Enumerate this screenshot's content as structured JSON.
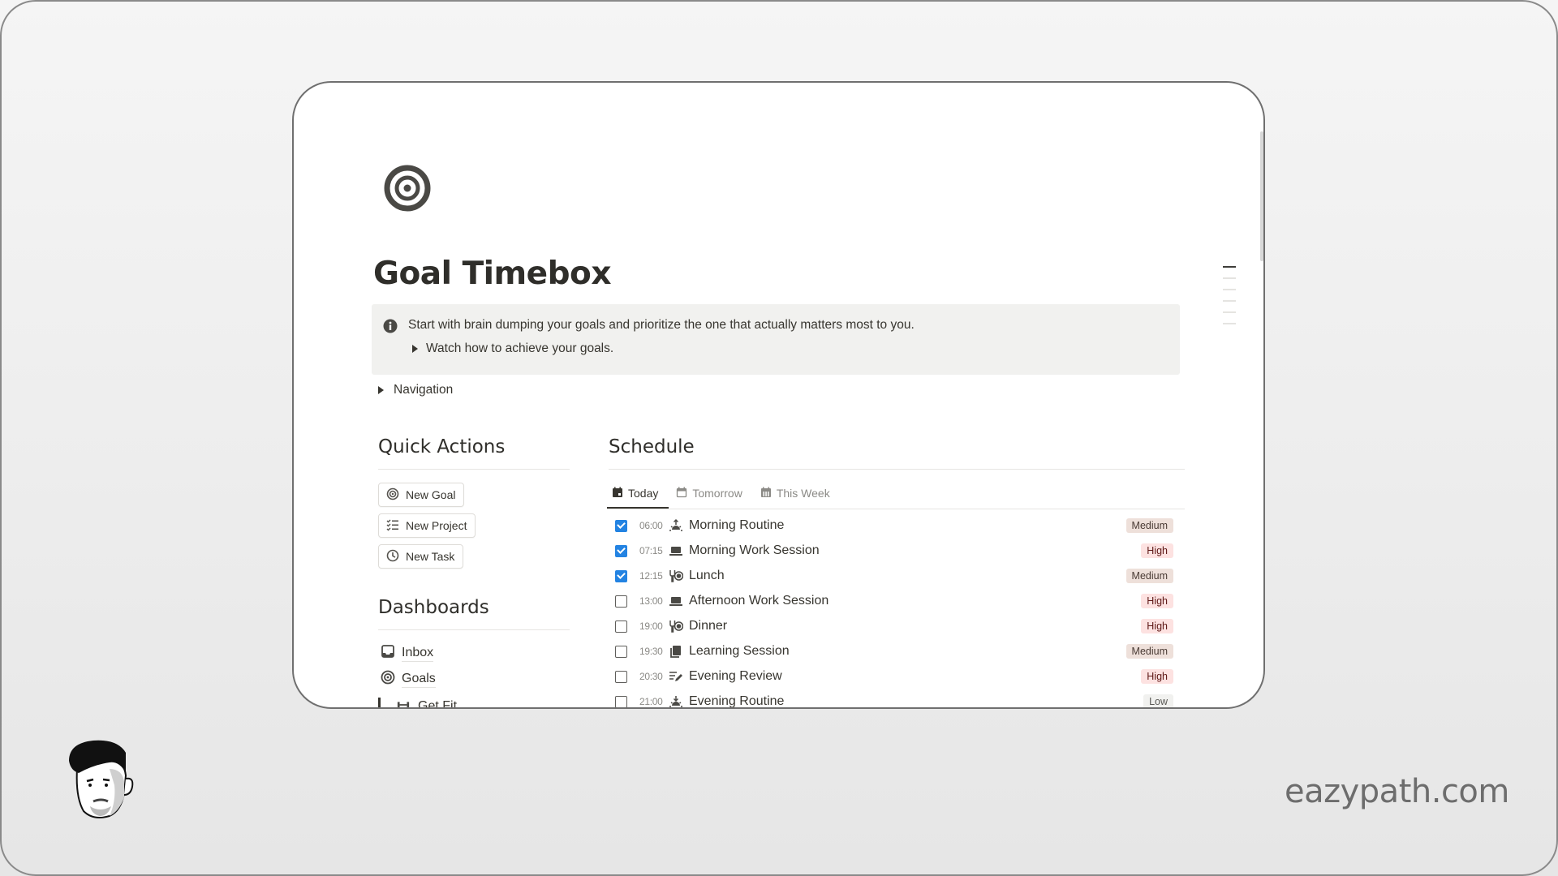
{
  "page": {
    "title": "Goal Timebox",
    "icon": "target-icon"
  },
  "callout": {
    "icon": "info-icon",
    "text": "Start with brain dumping your goals and prioritize the one that actually matters most to you.",
    "toggle_label": "Watch how to achieve your goals."
  },
  "navigation_toggle": "Navigation",
  "quick_actions": {
    "title": "Quick Actions",
    "buttons": [
      {
        "label": "New Goal",
        "icon": "target-icon"
      },
      {
        "label": "New Project",
        "icon": "checklist-icon"
      },
      {
        "label": "New Task",
        "icon": "clock-icon"
      }
    ]
  },
  "dashboards": {
    "title": "Dashboards",
    "items": [
      {
        "label": "Inbox",
        "icon": "inbox-icon"
      },
      {
        "label": "Goals",
        "icon": "target-icon"
      },
      {
        "label": "Get Fit",
        "icon": "dumbbell-icon"
      }
    ]
  },
  "schedule": {
    "title": "Schedule",
    "tabs": [
      {
        "label": "Today",
        "icon": "calendar-filled-icon",
        "active": true
      },
      {
        "label": "Tomorrow",
        "icon": "calendar-icon",
        "active": false
      },
      {
        "label": "This Week",
        "icon": "calendar-week-icon",
        "active": false
      }
    ],
    "rows": [
      {
        "done": true,
        "time": "06:00",
        "icon": "sunrise-icon",
        "name": "Morning Routine",
        "priority": "Medium"
      },
      {
        "done": true,
        "time": "07:15",
        "icon": "laptop-icon",
        "name": "Morning Work Session",
        "priority": "High"
      },
      {
        "done": true,
        "time": "12:15",
        "icon": "meal-icon",
        "name": "Lunch",
        "priority": "Medium"
      },
      {
        "done": false,
        "time": "13:00",
        "icon": "laptop-icon",
        "name": "Afternoon Work Session",
        "priority": "High"
      },
      {
        "done": false,
        "time": "19:00",
        "icon": "meal-icon",
        "name": "Dinner",
        "priority": "High"
      },
      {
        "done": false,
        "time": "19:30",
        "icon": "book-icon",
        "name": "Learning Session",
        "priority": "Medium"
      },
      {
        "done": false,
        "time": "20:30",
        "icon": "review-icon",
        "name": "Evening Review",
        "priority": "High"
      },
      {
        "done": false,
        "time": "21:00",
        "icon": "sunset-icon",
        "name": "Evening Routine",
        "priority": "Low"
      }
    ]
  },
  "colors": {
    "checkbox_checked": "#2383e2",
    "badge_high_bg": "#fde2e1",
    "badge_medium_bg": "#eee0da",
    "badge_low_bg": "#f1f1ef",
    "callout_bg": "#f1f1ef"
  },
  "footer": {
    "brand": "eazypath.com",
    "avatar": "avatar-illustration"
  }
}
